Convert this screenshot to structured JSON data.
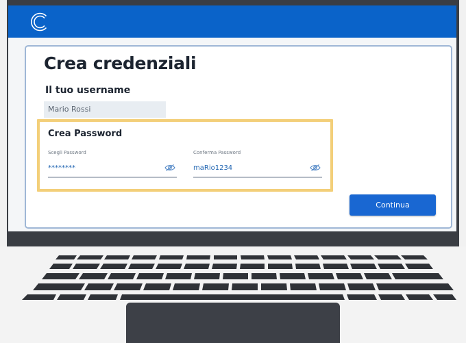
{
  "brand": {
    "logo_icon": "c-logo-icon",
    "topbar_color": "#0a63c9"
  },
  "page": {
    "title": "Crea credenziali"
  },
  "username": {
    "heading": "Il tuo username",
    "value": "Mario Rossi"
  },
  "password": {
    "heading": "Crea Password",
    "choose_label": "Scegli Password",
    "choose_value": "********",
    "confirm_label": "Conferma Password",
    "confirm_value": "maRio1234",
    "toggle_icon": "eye-icon",
    "highlight_color": "#f3cf79"
  },
  "actions": {
    "continue_label": "Continua",
    "accent": "#1967d2"
  }
}
